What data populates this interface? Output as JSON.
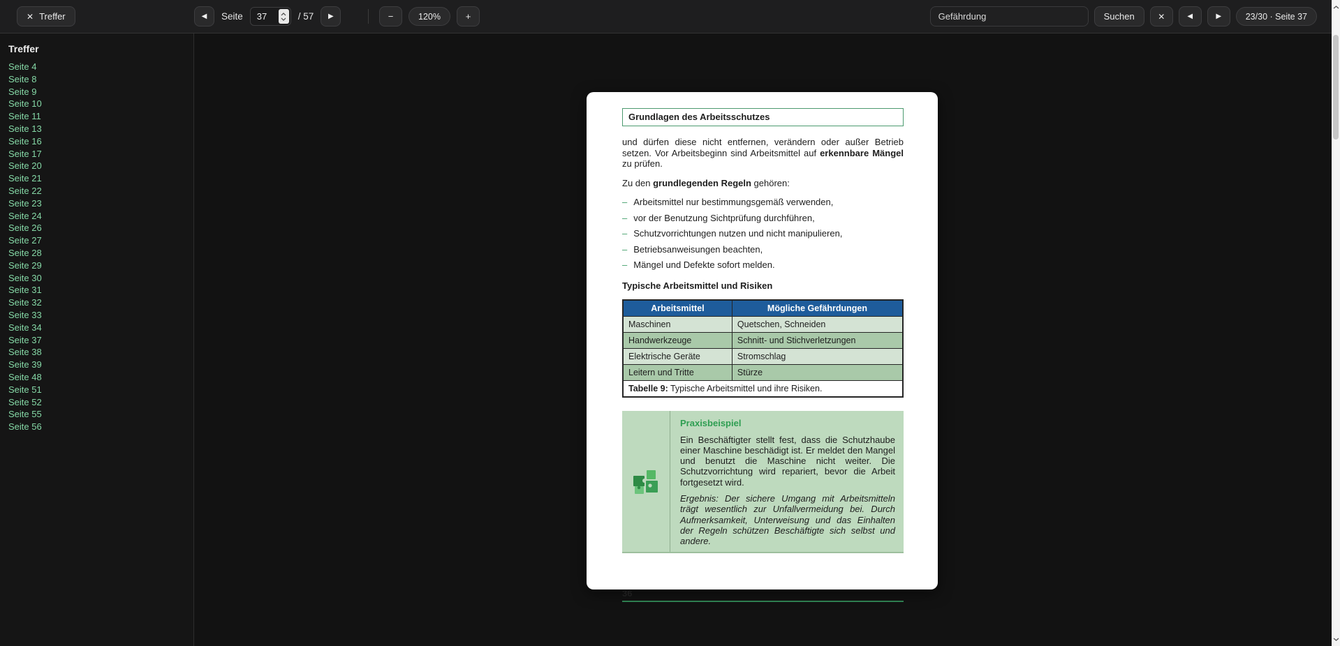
{
  "toolbar": {
    "results_toggle_label": "Treffer",
    "page_label": "Seite",
    "current_page": "37",
    "total_pages": "/ 57",
    "zoom_level": "120%",
    "search_query": "Gefährdung",
    "search_label": "Suchen",
    "match_status": "23/30 · Seite 37",
    "icons": {
      "close": "✕",
      "prev": "◀",
      "next": "▶",
      "minus": "−",
      "plus": "+"
    }
  },
  "sidebar": {
    "title": "Treffer",
    "results": [
      "Seite 4",
      "Seite 8",
      "Seite 9",
      "Seite 10",
      "Seite 11",
      "Seite 13",
      "Seite 16",
      "Seite 17",
      "Seite 20",
      "Seite 21",
      "Seite 22",
      "Seite 23",
      "Seite 24",
      "Seite 26",
      "Seite 27",
      "Seite 28",
      "Seite 29",
      "Seite 30",
      "Seite 31",
      "Seite 32",
      "Seite 33",
      "Seite 34",
      "Seite 37",
      "Seite 38",
      "Seite 39",
      "Seite 48",
      "Seite 51",
      "Seite 52",
      "Seite 55",
      "Seite 56"
    ]
  },
  "document": {
    "header_title": "Grundlagen des Arbeitsschutzes",
    "para1_pre": "und dürfen diese nicht entfernen, verändern oder außer Betrieb setzen. Vor Arbeitsbeginn sind Arbeitsmittel auf ",
    "para1_bold": "erkennbare Mängel",
    "para1_post": " zu prüfen.",
    "para2_pre": "Zu den ",
    "para2_bold": "grundlegenden Regeln",
    "para2_post": " gehören:",
    "bullet_marker": "–",
    "bullets": [
      "Arbeitsmittel nur bestimmungsgemäß verwenden,",
      "vor der Benutzung Sichtprüfung durchführen,",
      "Schutzvorrichtungen nutzen und nicht manipulieren,",
      "Betriebsanweisungen beachten,",
      "Mängel und Defekte sofort melden."
    ],
    "table_heading": "Typische Arbeitsmittel und Risiken",
    "table": {
      "headers": [
        "Arbeitsmittel",
        "Mögliche Gefährdungen"
      ],
      "rows": [
        [
          "Maschinen",
          "Quetschen, Schneiden"
        ],
        [
          "Handwerkzeuge",
          "Schnitt- und Stichverletzungen"
        ],
        [
          "Elektrische Geräte",
          "Stromschlag"
        ],
        [
          "Leitern und Tritte",
          "Stürze"
        ]
      ],
      "caption_bold": "Tabelle 9:",
      "caption_text": " Typische Arbeitsmittel und ihre Risiken."
    },
    "example": {
      "title": "Praxisbeispiel",
      "para1": "Ein Beschäftigter stellt fest, dass die Schutzhaube einer Ma­schine beschädigt ist. Er meldet den Mangel und benutzt die Maschine nicht weiter. Die Schutzvorrichtung wird repariert, bevor die Arbeit fortgesetzt wird.",
      "para2": "Ergebnis: Der sichere Umgang mit Arbeitsmitteln trägt we­sentlich zur Unfallvermeidung bei. Durch Aufmerksamkeit, Unterweisung und das Einhalten der Regeln schützen Be­schäftigte sich selbst und andere."
    },
    "page_number": "36"
  },
  "colors": {
    "toolbar_bg": "#1e1e1f",
    "canvas_bg": "#121212",
    "sidebar_bg": "#151515",
    "button_bg": "#2a2a2b",
    "button_border": "#3d3d3f",
    "result_link": "#85d8a6",
    "doc_border_green": "#4c9a6f",
    "table_header_bg": "#1e5c9b",
    "table_row_a": "#a9c9a9",
    "table_row_b": "#d4e3d4",
    "example_bg": "#bedabe",
    "example_green": "#2f9e52",
    "footer_line": "#2e7d4f",
    "bullet_dash": "#3f9e68"
  }
}
